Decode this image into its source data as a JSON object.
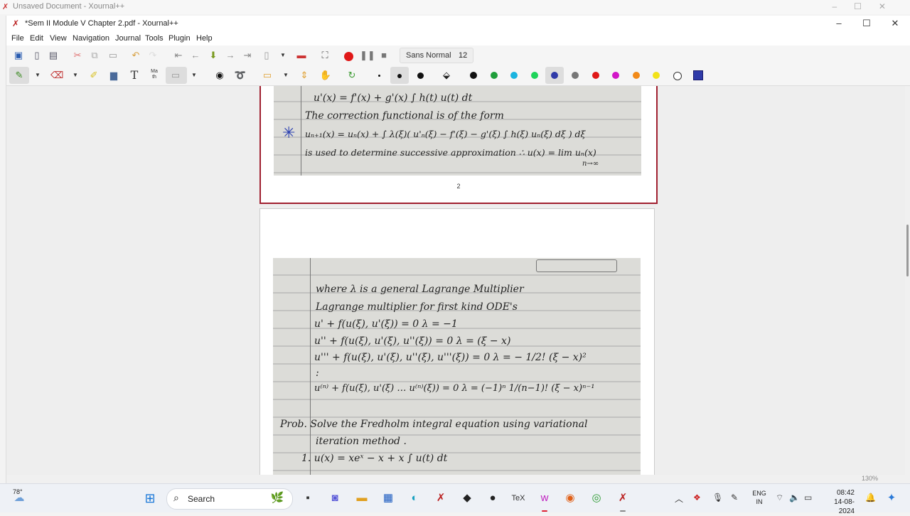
{
  "background_window": {
    "title": "Unsaved Document - Xournal++"
  },
  "window": {
    "title": "*Sem II Module V Chapter 2.pdf - Xournal++",
    "controls": [
      "–",
      "☐",
      "✕"
    ]
  },
  "menu": [
    "File",
    "Edit",
    "View",
    "Navigation",
    "Journal",
    "Tools",
    "Plugin",
    "Help"
  ],
  "toolbar": {
    "font_name": "Sans Normal",
    "font_size": "12",
    "text_tool_glyph": "T",
    "math_tool_glyph": "Ma\nth"
  },
  "colors": {
    "palette": [
      "#111111",
      "#1f9e3a",
      "#1ab4e0",
      "#1ed45a",
      "#2f3aa8",
      "#777777",
      "#e01818",
      "#d216c8",
      "#f28a18",
      "#f2e218",
      "#ffffff"
    ],
    "selected_color": "#2f3aa8",
    "record": "#e01818",
    "page_border": "#a02030",
    "ink_blue": "#2a3fb0"
  },
  "page1": {
    "page_number": "2",
    "lines": [
      "u'(x) = f'(x) + g'(x) ∫ h(t) u(t) dt",
      "The correction functional is of the form",
      "uₙ₊₁(x) = uₙ(x) + ∫ λ(ξ)( u'ₙ(ξ) − f'(ξ) − g'(ξ) ∫ h(ξ) uₙ(ξ) dξ ) dξ",
      "is used to determine successive approximation ∴  u(x) = lim uₙ(x)",
      "n→∞"
    ],
    "annotation": "✳"
  },
  "page2": {
    "lines": [
      "where λ is a general Lagrange Multiplier",
      "Lagrange multiplier for first kind ODE's",
      "u' + f(u(ξ), u'(ξ)) = 0     λ = −1",
      "u'' + f(u(ξ), u'(ξ), u''(ξ)) = 0   λ = (ξ − x)",
      "u''' + f(u(ξ), u'(ξ), u''(ξ), u'''(ξ)) = 0   λ = − 1/2! (ξ − x)²",
      ":",
      "u⁽ⁿ⁾ + f(u(ξ), u'(ξ) … u⁽ⁿ⁾(ξ)) = 0   λ = (−1)ⁿ 1/(n−1)! (ξ − x)ⁿ⁻¹",
      "Prob.  Solve the Fredholm integral equation using variational",
      "iteration method .",
      "1.  u(x) = xeˣ − x + x ∫ u(t) dt"
    ]
  },
  "zoom": "130%",
  "taskbar": {
    "weather": "78°",
    "search_placeholder": "Search",
    "language": "ENG\nIN",
    "time": "08:42",
    "date": "14-08-2024"
  }
}
